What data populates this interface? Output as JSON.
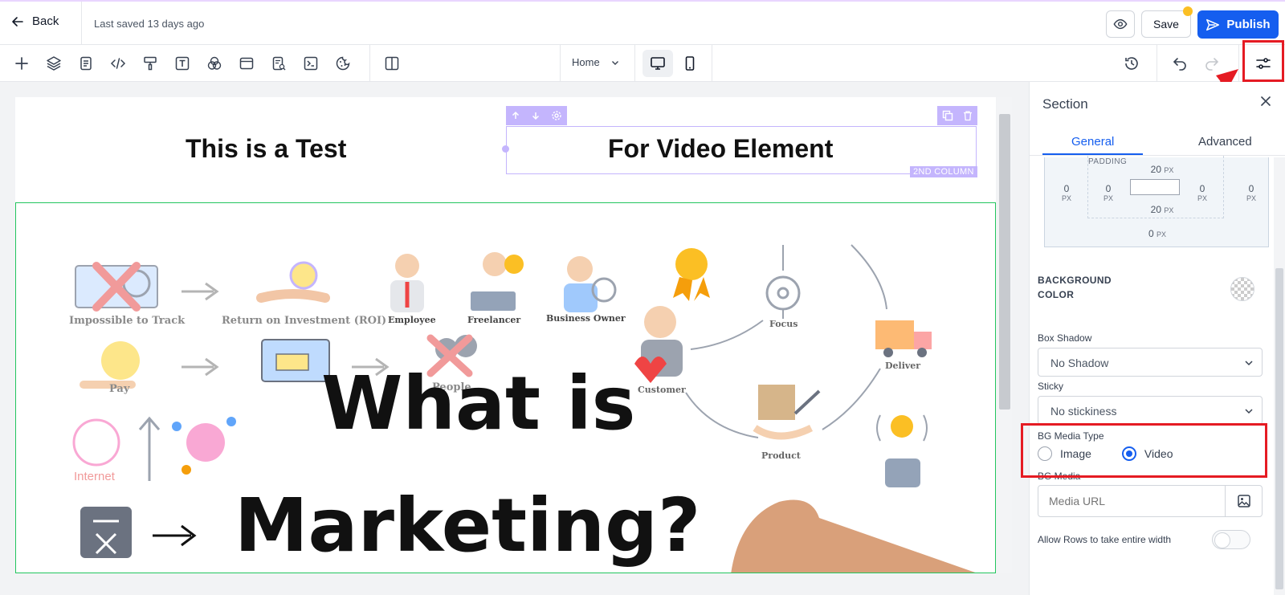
{
  "topbar": {
    "back_label": "Back",
    "last_saved": "Last saved 13 days ago",
    "save_label": "Save",
    "publish_label": "Publish"
  },
  "toolbar": {
    "page_name": "Home"
  },
  "canvas": {
    "heading_left": "This is a Test",
    "heading_right": "For Video Element",
    "column_tag": "2ND COLUMN",
    "video_frame": {
      "title_line1": "What is",
      "title_line2": "Marketing?",
      "labels": [
        "Impossible to Track",
        "Return on Investment (ROI)",
        "Employee",
        "Freelancer",
        "Business Owner",
        "Focus",
        "Deliver",
        "Customer",
        "Pay",
        "People",
        "Product",
        "Internet"
      ]
    }
  },
  "panel": {
    "title": "Section",
    "tabs": [
      "General",
      "Advanced"
    ],
    "box_model": {
      "margin_left": "0",
      "margin_right": "0",
      "margin_bottom": "0",
      "padding_label": "PADDING",
      "padding_top": "20",
      "padding_bottom": "20",
      "padding_left": "0",
      "padding_right": "0",
      "unit": "PX"
    },
    "background_color_label_1": "BACKGROUND",
    "background_color_label_2": "COLOR",
    "box_shadow_label": "Box Shadow",
    "box_shadow_value": "No Shadow",
    "sticky_label": "Sticky",
    "sticky_value": "No stickiness",
    "bg_media_type_label": "BG Media Type",
    "media_type_options": [
      "Image",
      "Video"
    ],
    "media_type_selected": "Video",
    "bg_media_label": "BG Media",
    "media_url_placeholder": "Media URL",
    "allow_rows_label": "Allow Rows to take entire width"
  },
  "colors": {
    "accent": "#155eef",
    "highlight": "#e51b23",
    "column_outline": "#c4b5fd",
    "section_outline": "#22c55e"
  }
}
